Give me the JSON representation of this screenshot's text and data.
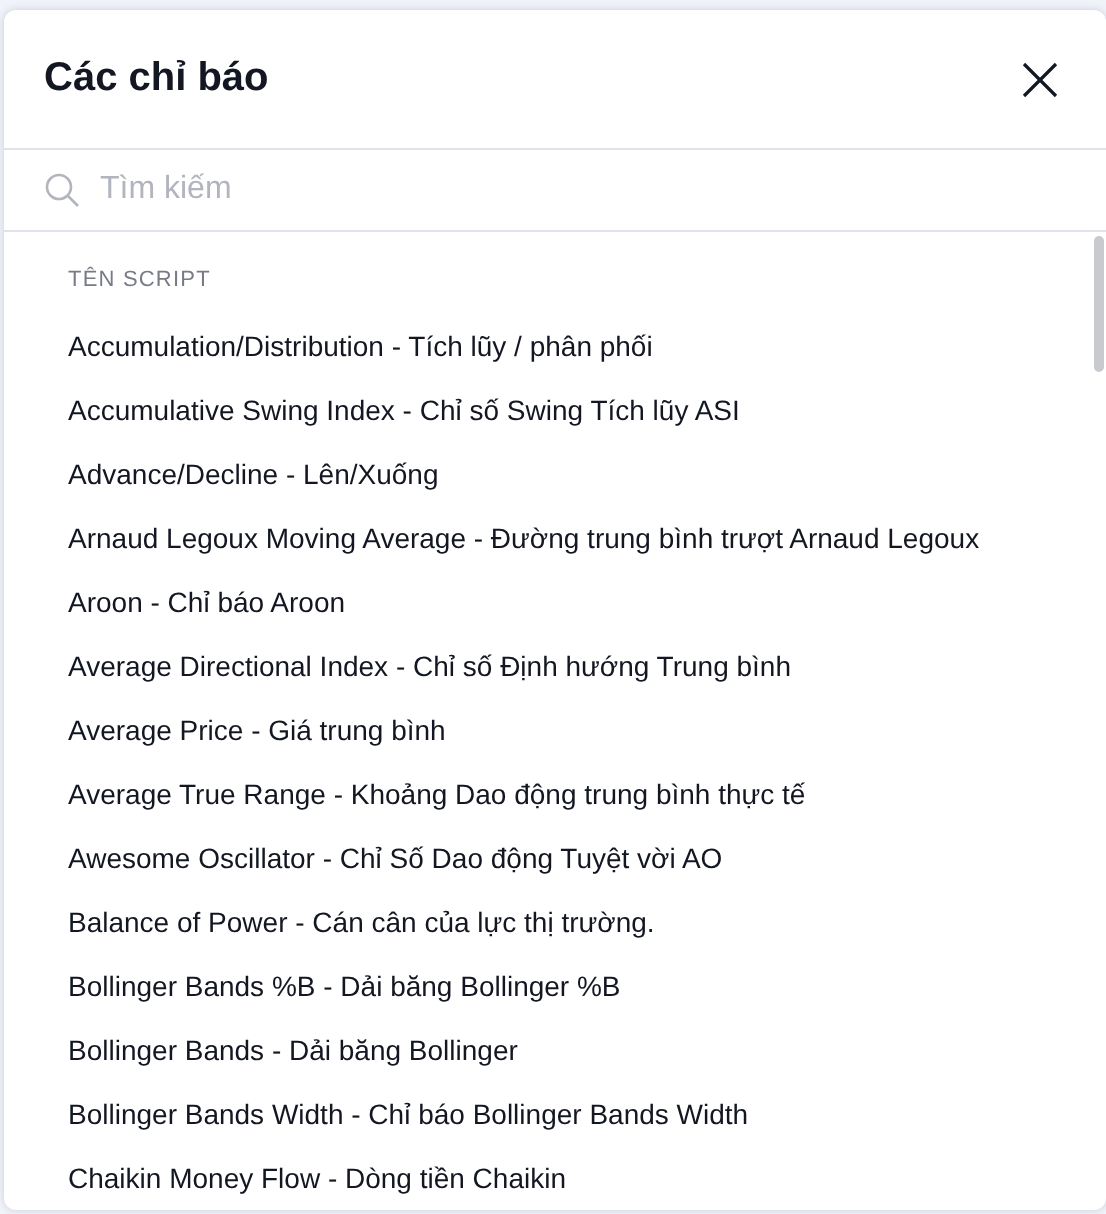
{
  "dialog": {
    "title": "Các chỉ báo"
  },
  "search": {
    "placeholder": "Tìm kiếm"
  },
  "list": {
    "section_label": "TÊN SCRIPT",
    "items": [
      "Accumulation/Distribution - Tích lũy / phân phối",
      "Accumulative Swing Index - Chỉ số Swing Tích lũy ASI",
      "Advance/Decline - Lên/Xuống",
      "Arnaud Legoux Moving Average - Đường trung bình trượt Arnaud Legoux",
      "Aroon - Chỉ báo Aroon",
      "Average Directional Index - Chỉ số Định hướng Trung bình",
      "Average Price - Giá trung bình",
      "Average True Range - Khoảng Dao động trung bình thực tế",
      "Awesome Oscillator - Chỉ Số Dao động Tuyệt vời AO",
      "Balance of Power - Cán cân của lực thị trường.",
      "Bollinger Bands %B - Dải băng Bollinger %B",
      "Bollinger Bands - Dải băng Bollinger",
      "Bollinger Bands Width - Chỉ báo Bollinger Bands Width",
      "Chaikin Money Flow - Dòng tiền Chaikin"
    ]
  }
}
